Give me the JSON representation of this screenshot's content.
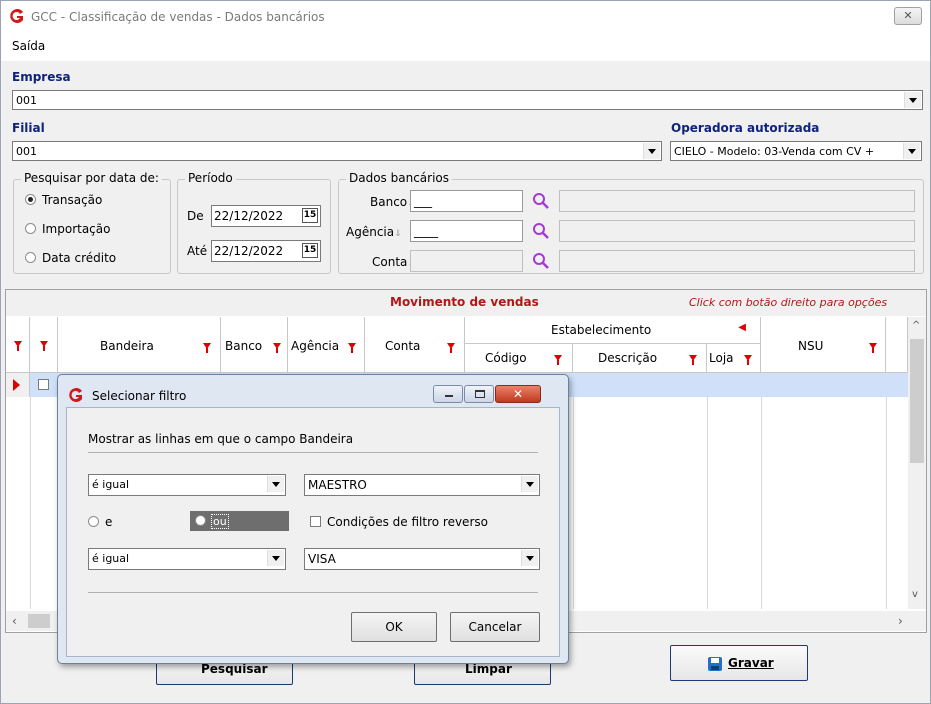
{
  "window": {
    "title": "GCC - Classificação de vendas - Dados bancários",
    "close_glyph": "✕"
  },
  "menu": {
    "saida": "Saída"
  },
  "empresa": {
    "label": "Empresa",
    "value": "001"
  },
  "filial": {
    "label": "Filial",
    "value": "001"
  },
  "operadora": {
    "label": "Operadora autorizada",
    "value": "CIELO - Modelo: 03-Venda com CV +"
  },
  "pesquisar": {
    "title": "Pesquisar por data de:",
    "options": [
      "Transação",
      "Importação",
      "Data crédito"
    ],
    "selected": "Transação"
  },
  "periodo": {
    "title": "Período",
    "de_label": "De",
    "de_value": "22/12/2022",
    "ate_label": "Até",
    "ate_value": "22/12/2022",
    "cal_glyph": "15"
  },
  "dados": {
    "title": "Dados bancários",
    "banco": "Banco",
    "agencia": "Agência",
    "conta": "Conta",
    "banco_value": "___",
    "agencia_value": "____"
  },
  "grid": {
    "title": "Movimento de vendas",
    "hint": "Click com botão direito para opções",
    "columns": {
      "bandeira": "Bandeira",
      "banco": "Banco",
      "agencia": "Agência",
      "conta": "Conta",
      "estabelecimento": "Estabelecimento",
      "codigo": "Código",
      "descricao": "Descrição",
      "loja": "Loja",
      "nsu": "NSU"
    }
  },
  "buttons": {
    "pesquisar": "Pesquisar",
    "limpar": "Limpar",
    "gravar": "Gravar"
  },
  "dialog": {
    "title": "Selecionar filtro",
    "prompt": "Mostrar as linhas em que o campo Bandeira",
    "cond1_op": "é igual",
    "cond1_val": "MAESTRO",
    "and_label": "e",
    "or_label": "ou",
    "selected_logic": "ou",
    "reverse_label": "Condições de filtro reverso",
    "cond2_op": "é igual",
    "cond2_val": "VISA",
    "ok": "OK",
    "cancel": "Cancelar"
  },
  "colors": {
    "accent_blue": "#0e237a",
    "filter_red": "#e00000",
    "grid_title": "#b01818",
    "selection": "#cfe0f8"
  }
}
